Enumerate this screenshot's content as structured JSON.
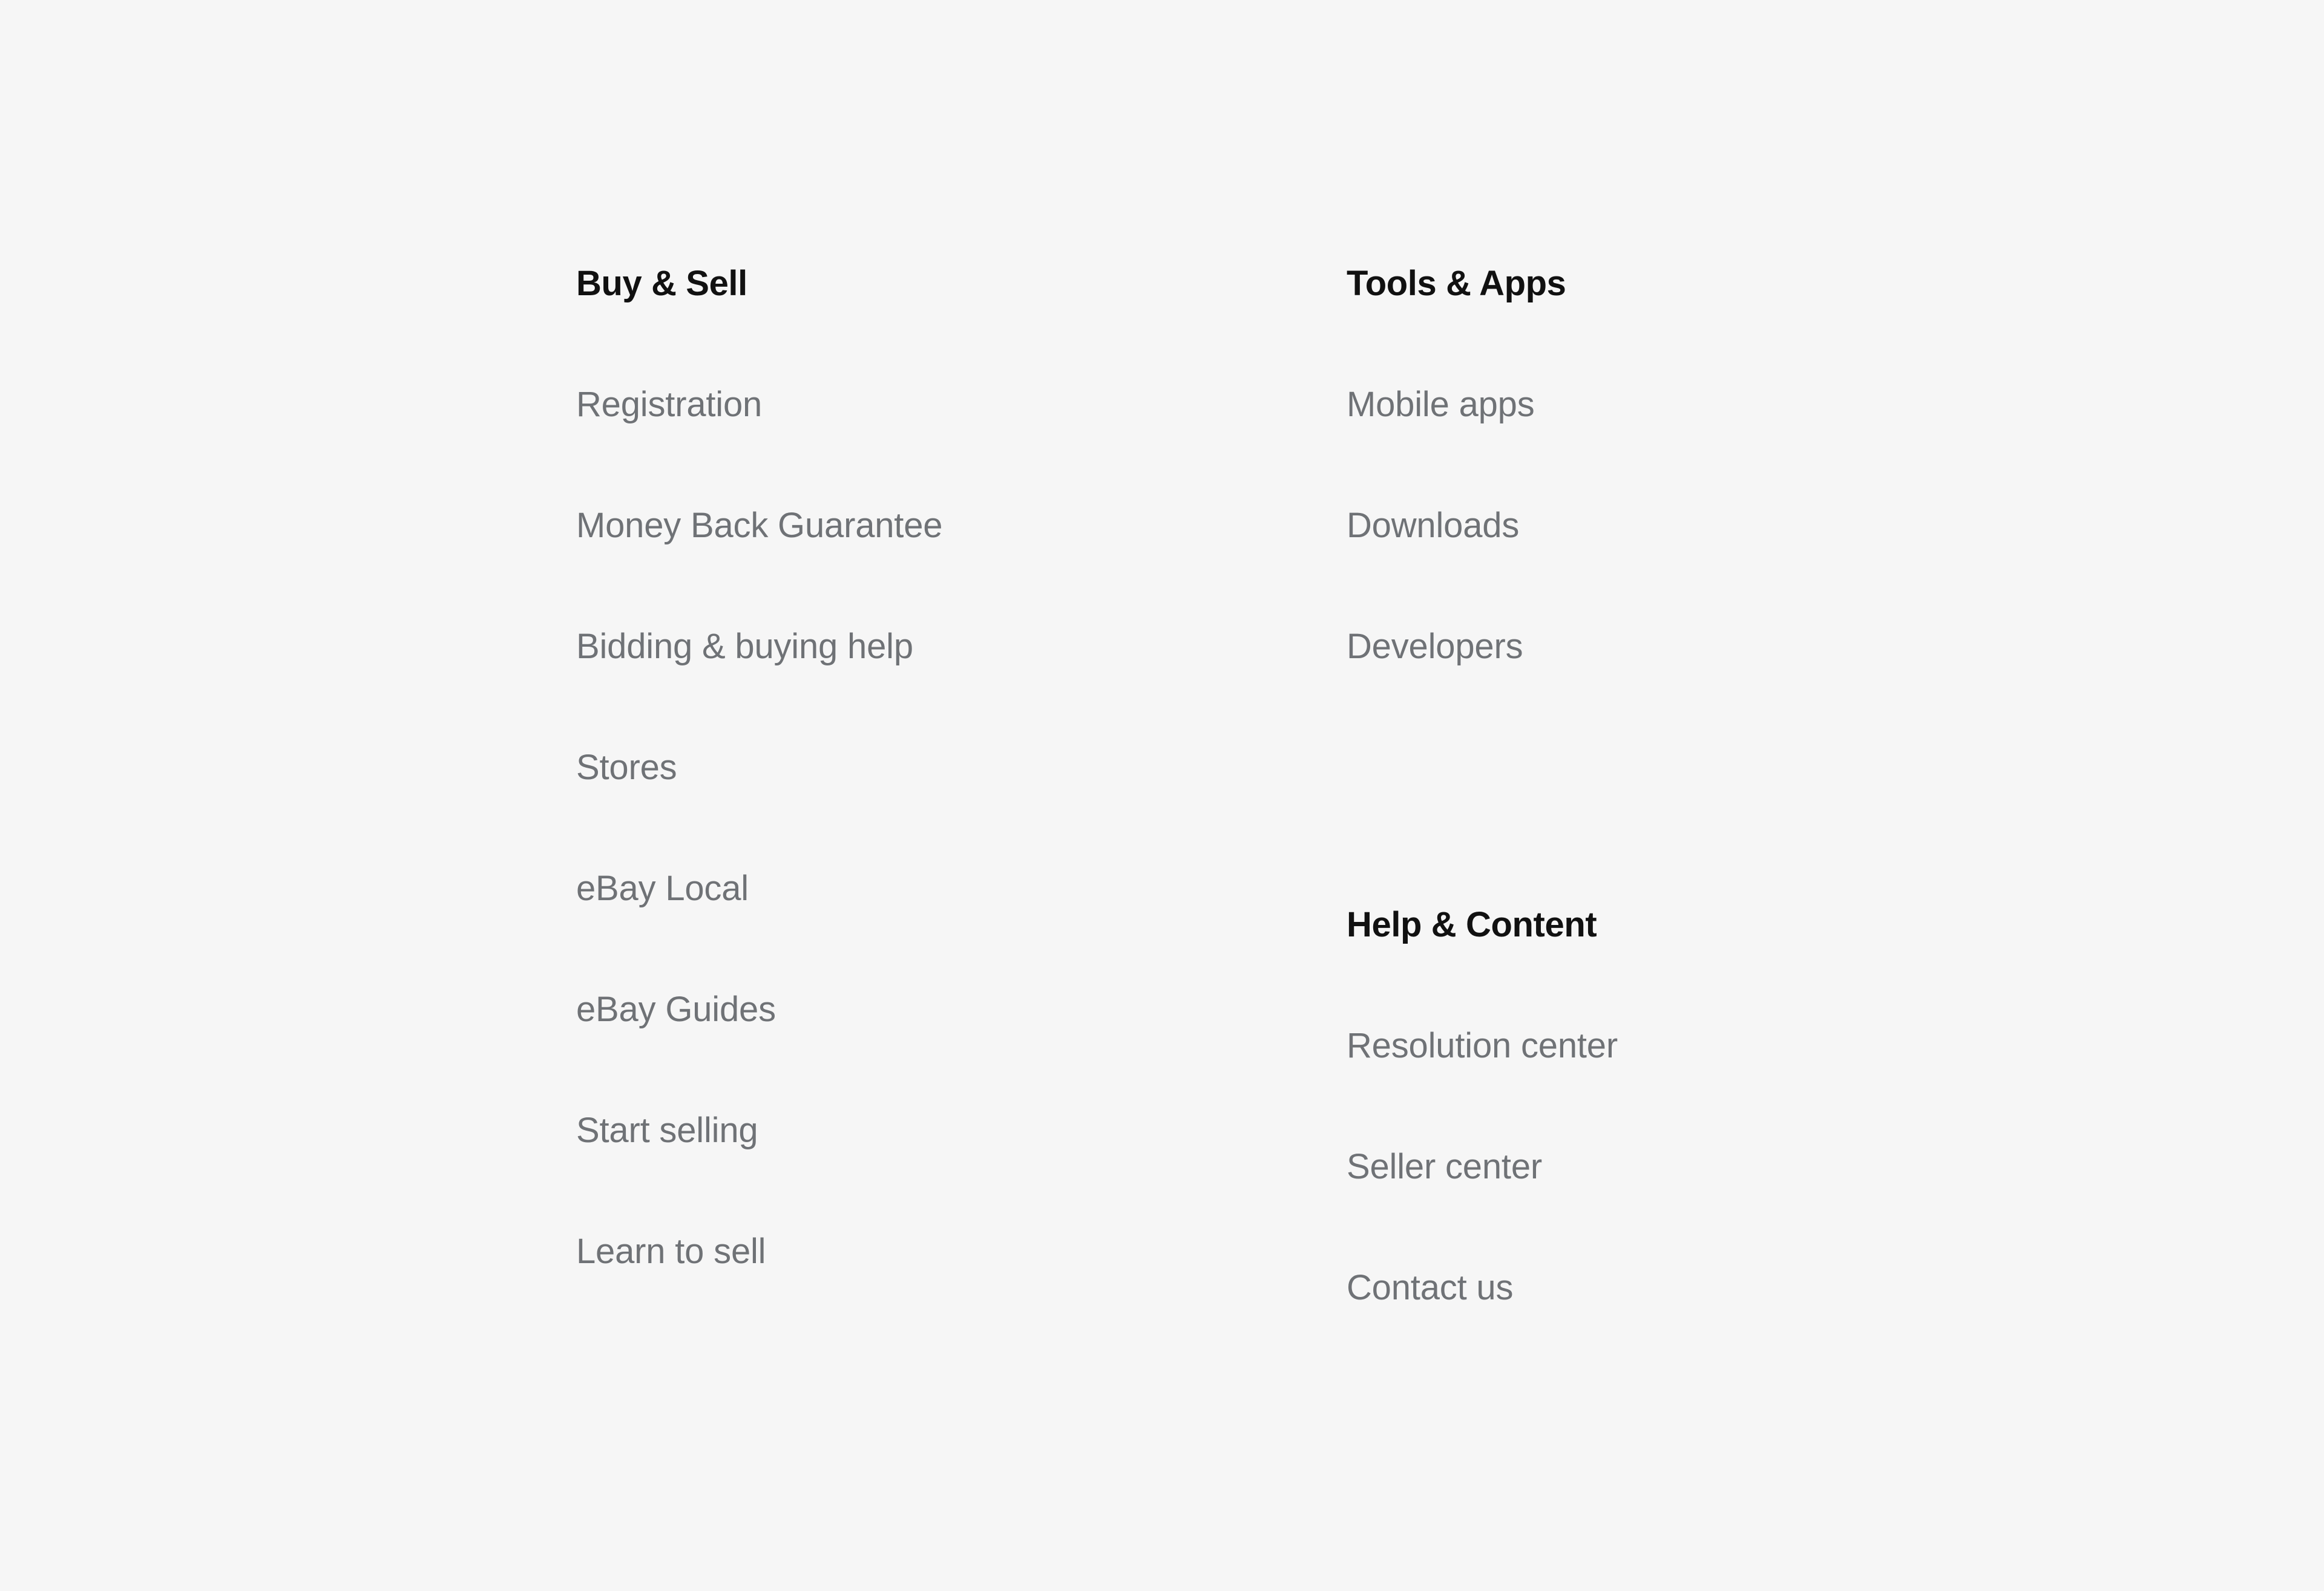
{
  "page": {
    "background_color": "#f6f6f6",
    "heading_color": "#111111",
    "link_color": "#6f7276"
  },
  "footer": {
    "columns": [
      {
        "id": "buy-sell",
        "groups": [
          {
            "id": "buy-sell",
            "heading": "Buy & Sell",
            "links": [
              "Registration",
              "Money Back Guarantee",
              "Bidding & buying help",
              "Stores",
              "eBay Local",
              "eBay Guides",
              "Start selling",
              "Learn to sell"
            ]
          }
        ]
      },
      {
        "id": "tools-help",
        "groups": [
          {
            "id": "tools-apps",
            "heading": "Tools & Apps",
            "links": [
              "Mobile apps",
              "Downloads",
              "Developers"
            ]
          },
          {
            "id": "help-content",
            "heading": "Help & Content",
            "links": [
              "Resolution center",
              "Seller center",
              "Contact us"
            ]
          }
        ]
      }
    ]
  }
}
